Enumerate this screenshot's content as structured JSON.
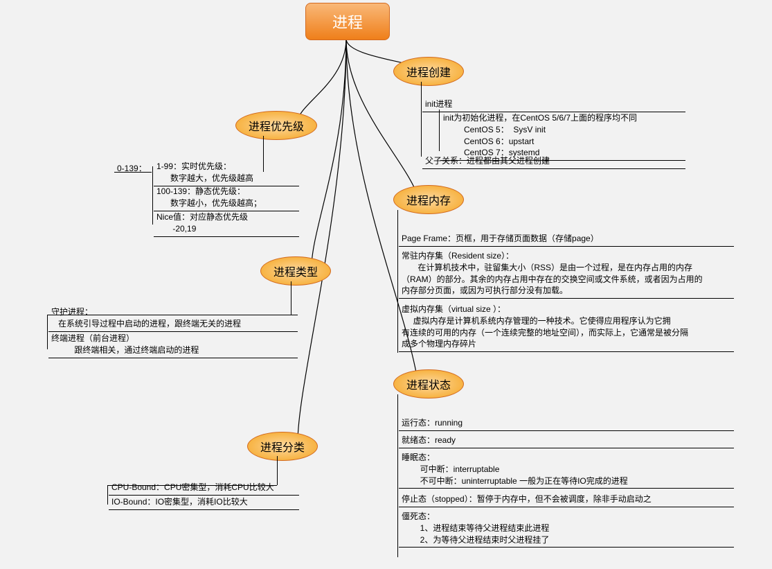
{
  "root": "进程",
  "branches": {
    "priority": {
      "label": "进程优先级",
      "range": "0-139：",
      "l1": "1-99：实时优先级：\n      数字越大，优先级越高",
      "l2": "100-139：静态优先级：\n      数字越小，优先级越高；",
      "l3": "Nice值：对应静态优先级\n       -20,19"
    },
    "type": {
      "label": "进程类型",
      "l1": "守护进程：\n   在系统引导过程中启动的进程，跟终端无关的进程",
      "l2": "终端进程（前台进程）\n          跟终端相关，通过终端启动的进程"
    },
    "classify": {
      "label": "进程分类",
      "l1": "CPU-Bound：CPU密集型，消耗CPU比较大",
      "l2": "IO-Bound：IO密集型，消耗IO比较大"
    },
    "create": {
      "label": "进程创建",
      "init": "init进程",
      "initdesc": "init为初始化进程，在CentOS 5/6/7上面的程序均不同\n         CentOS 5：  SysV init\n         CentOS 6：upstart\n         CentOS 7：systemd",
      "parent": "父子关系：进程都由其父进程创建"
    },
    "memory": {
      "label": "进程内存",
      "pageframe": "Page Frame：页框，用于存储页面数据（存储page）",
      "rss": "常驻内存集（Resident size）：\n       在计算机技术中，驻留集大小（RSS）是由一个过程，是在内存占用的内存\n（RAM）的部分。其余的内存占用中存在的交换空间或文件系统，或者因为占用的\n内存部分页面，或因为可执行部分没有加载。",
      "virtual": "虚拟内存集（virtual size ）：\n     虚拟内存是计算机系统内存管理的一种技术。它使得应用程序认为它拥\n有连续的可用的内存（一个连续完整的地址空间），而实际上，它通常是被分隔\n成多个物理内存碎片"
    },
    "status": {
      "label": "进程状态",
      "running": "运行态：running",
      "ready": "就绪态：ready",
      "sleep": "睡眠态：\n        可中断：interruptable\n        不可中断：uninterruptable 一般为正在等待IO完成的进程",
      "stopped": "停止态（stopped）：暂停于内存中，但不会被调度，除非手动启动之",
      "zombie": "僵死态：\n        1、进程结束等待父进程结束此进程\n        2、为等待父进程结束时父进程挂了"
    }
  }
}
